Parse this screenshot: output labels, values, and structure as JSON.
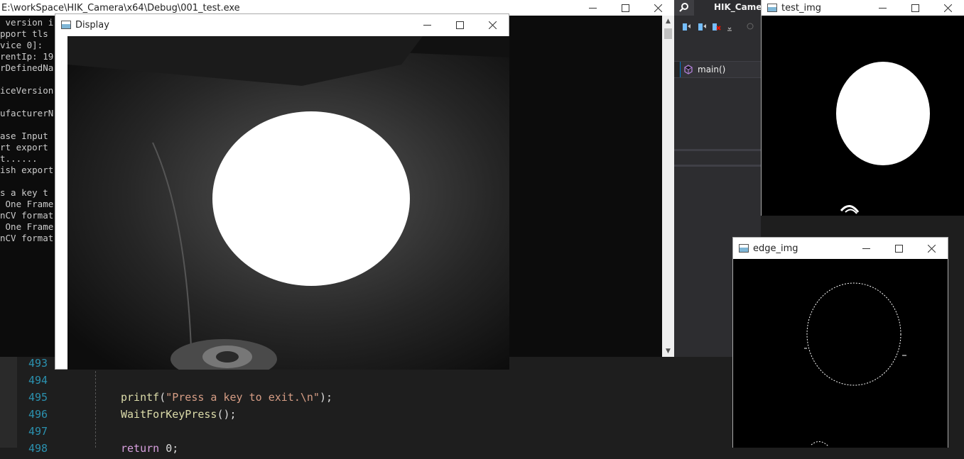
{
  "console": {
    "title": "E:\\workSpace\\HIK_Camera\\x64\\Debug\\001_test.exe",
    "lines": [
      " version i",
      "pport tls ",
      "vice 0]:",
      "rentIp: 19",
      "rDefinedNa",
      "",
      "iceVersion",
      "",
      "ufacturerN",
      "",
      "ase Input ",
      "rt export ",
      "t......",
      "ish export",
      "",
      "s a key t",
      " One Frame",
      "nCV format",
      " One Frame",
      "nCV format"
    ]
  },
  "editor": {
    "lines": [
      {
        "num": "493",
        "code": ""
      },
      {
        "num": "494",
        "code": ""
      },
      {
        "num": "495",
        "fn": "printf",
        "open": "(",
        "str": "\"Press a key to exit.\\n\"",
        "close": ");"
      },
      {
        "num": "496",
        "fn": "WaitForKeyPress",
        "open": "()",
        "str": "",
        "close": ";"
      },
      {
        "num": "497",
        "code": ""
      },
      {
        "num": "498",
        "kw": "return",
        "rest": " 0;"
      }
    ]
  },
  "ide": {
    "tab_title": "HIK_Camer",
    "nav_symbol": "main()"
  },
  "display": {
    "title": "Display"
  },
  "test_img": {
    "title": "test_img"
  },
  "edge_img": {
    "title": "edge_img"
  },
  "colors": {
    "accent": "#007acc",
    "console_bg": "#0c0c0c",
    "editor_bg": "#1e1e1e",
    "line_number": "#2b91af"
  }
}
